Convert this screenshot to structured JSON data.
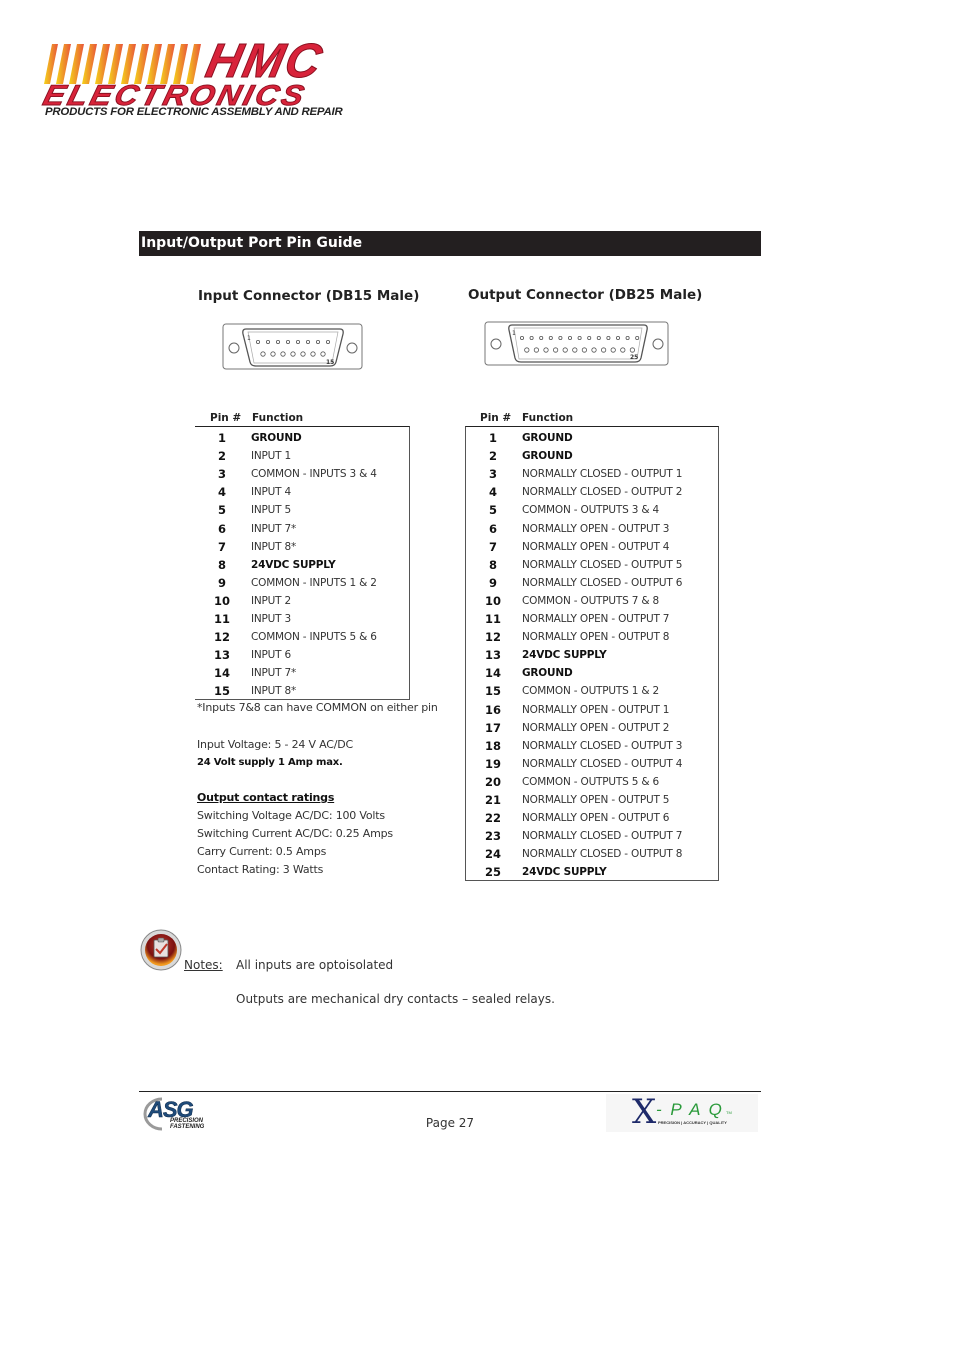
{
  "header": {
    "logo": {
      "brand_line1": "HMC",
      "brand_line2": "ELECTRONICS",
      "tagline": "PRODUCTS FOR ELECTRONIC ASSEMBLY AND REPAIR",
      "colors": {
        "red": "#d8233a",
        "stripe_start": "#f5d31a",
        "stripe_end": "#e8563a"
      }
    }
  },
  "section": {
    "title": "Input/Output Port Pin Guide",
    "bar_color": "#231f20"
  },
  "input_connector": {
    "title": "Input Connector (DB15 Male)",
    "diagram_labels": {
      "first_pin": "1",
      "last_pin": "15"
    },
    "table": {
      "headers": {
        "pin": "Pin #",
        "function": "Function"
      },
      "rows": [
        {
          "pin": "1",
          "function": "GROUND",
          "bold": true
        },
        {
          "pin": "2",
          "function": "INPUT 1",
          "bold": false
        },
        {
          "pin": "3",
          "function": "COMMON - INPUTS 3 & 4",
          "bold": false
        },
        {
          "pin": "4",
          "function": "INPUT 4",
          "bold": false
        },
        {
          "pin": "5",
          "function": "INPUT 5",
          "bold": false
        },
        {
          "pin": "6",
          "function": "INPUT 7*",
          "bold": false
        },
        {
          "pin": "7",
          "function": "INPUT 8*",
          "bold": false
        },
        {
          "pin": "8",
          "function": "24VDC SUPPLY",
          "bold": true
        },
        {
          "pin": "9",
          "function": "COMMON - INPUTS 1 & 2",
          "bold": false
        },
        {
          "pin": "10",
          "function": "INPUT 2",
          "bold": false
        },
        {
          "pin": "11",
          "function": "INPUT 3",
          "bold": false
        },
        {
          "pin": "12",
          "function": "COMMON - INPUTS 5 & 6",
          "bold": false
        },
        {
          "pin": "13",
          "function": "INPUT 6",
          "bold": false
        },
        {
          "pin": "14",
          "function": "INPUT 7*",
          "bold": false
        },
        {
          "pin": "15",
          "function": "INPUT 8*",
          "bold": false
        }
      ],
      "footnote": "*Inputs 7&8 can have COMMON on either pin"
    },
    "specs": {
      "input_voltage": "Input Voltage:   5 - 24 V AC/DC",
      "supply": "24 Volt supply 1 Amp max."
    }
  },
  "output_ratings": {
    "title": "Output contact ratings",
    "items": [
      "Switching Voltage AC/DC: 100 Volts",
      "Switching Current AC/DC: 0.25 Amps",
      "Carry Current: 0.5 Amps",
      "Contact Rating: 3 Watts"
    ]
  },
  "output_connector": {
    "title": "Output Connector (DB25 Male)",
    "diagram_labels": {
      "first_pin": "1",
      "last_pin": "25"
    },
    "table": {
      "headers": {
        "pin": "Pin #",
        "function": "Function"
      },
      "rows": [
        {
          "pin": "1",
          "function": "GROUND",
          "bold": true
        },
        {
          "pin": "2",
          "function": "GROUND",
          "bold": true
        },
        {
          "pin": "3",
          "function": "NORMALLY CLOSED - OUTPUT 1",
          "bold": false
        },
        {
          "pin": "4",
          "function": "NORMALLY CLOSED - OUTPUT 2",
          "bold": false
        },
        {
          "pin": "5",
          "function": "COMMON - OUTPUTS 3 & 4",
          "bold": false
        },
        {
          "pin": "6",
          "function": "NORMALLY OPEN - OUTPUT 3",
          "bold": false
        },
        {
          "pin": "7",
          "function": "NORMALLY OPEN - OUTPUT 4",
          "bold": false
        },
        {
          "pin": "8",
          "function": "NORMALLY CLOSED - OUTPUT 5",
          "bold": false
        },
        {
          "pin": "9",
          "function": "NORMALLY CLOSED - OUTPUT 6",
          "bold": false
        },
        {
          "pin": "10",
          "function": "COMMON - OUTPUTS 7 & 8",
          "bold": false
        },
        {
          "pin": "11",
          "function": "NORMALLY OPEN - OUTPUT 7",
          "bold": false
        },
        {
          "pin": "12",
          "function": "NORMALLY OPEN - OUTPUT 8",
          "bold": false
        },
        {
          "pin": "13",
          "function": "24VDC SUPPLY",
          "bold": true
        },
        {
          "pin": "14",
          "function": "GROUND",
          "bold": true
        },
        {
          "pin": "15",
          "function": "COMMON - OUTPUTS 1 & 2",
          "bold": false
        },
        {
          "pin": "16",
          "function": "NORMALLY OPEN - OUTPUT 1",
          "bold": false
        },
        {
          "pin": "17",
          "function": "NORMALLY OPEN - OUTPUT 2",
          "bold": false
        },
        {
          "pin": "18",
          "function": "NORMALLY CLOSED - OUTPUT 3",
          "bold": false
        },
        {
          "pin": "19",
          "function": "NORMALLY CLOSED - OUTPUT 4",
          "bold": false
        },
        {
          "pin": "20",
          "function": "COMMON - OUTPUTS 5 & 6",
          "bold": false
        },
        {
          "pin": "21",
          "function": "NORMALLY OPEN - OUTPUT 5",
          "bold": false
        },
        {
          "pin": "22",
          "function": "NORMALLY OPEN - OUTPUT 6",
          "bold": false
        },
        {
          "pin": "23",
          "function": "NORMALLY CLOSED - OUTPUT 7",
          "bold": false
        },
        {
          "pin": "24",
          "function": "NORMALLY CLOSED - OUTPUT 8",
          "bold": false
        },
        {
          "pin": "25",
          "function": "24VDC SUPPLY",
          "bold": true
        }
      ]
    }
  },
  "notes": {
    "icon": "clipboard-check-icon",
    "label": "Notes:",
    "lines": [
      "All inputs are optoisolated",
      "Outputs are mechanical dry contacts – sealed relays."
    ]
  },
  "footer": {
    "left_logo": {
      "main": "ASG",
      "sub1": "PRECISION",
      "sub2": "FASTENING"
    },
    "page": "Page 27",
    "right_logo": {
      "main_x": "X",
      "main_rest": "- P A Q",
      "tm": "TM",
      "tagline": "PRECISION | ACCURACY | QUALITY"
    }
  }
}
